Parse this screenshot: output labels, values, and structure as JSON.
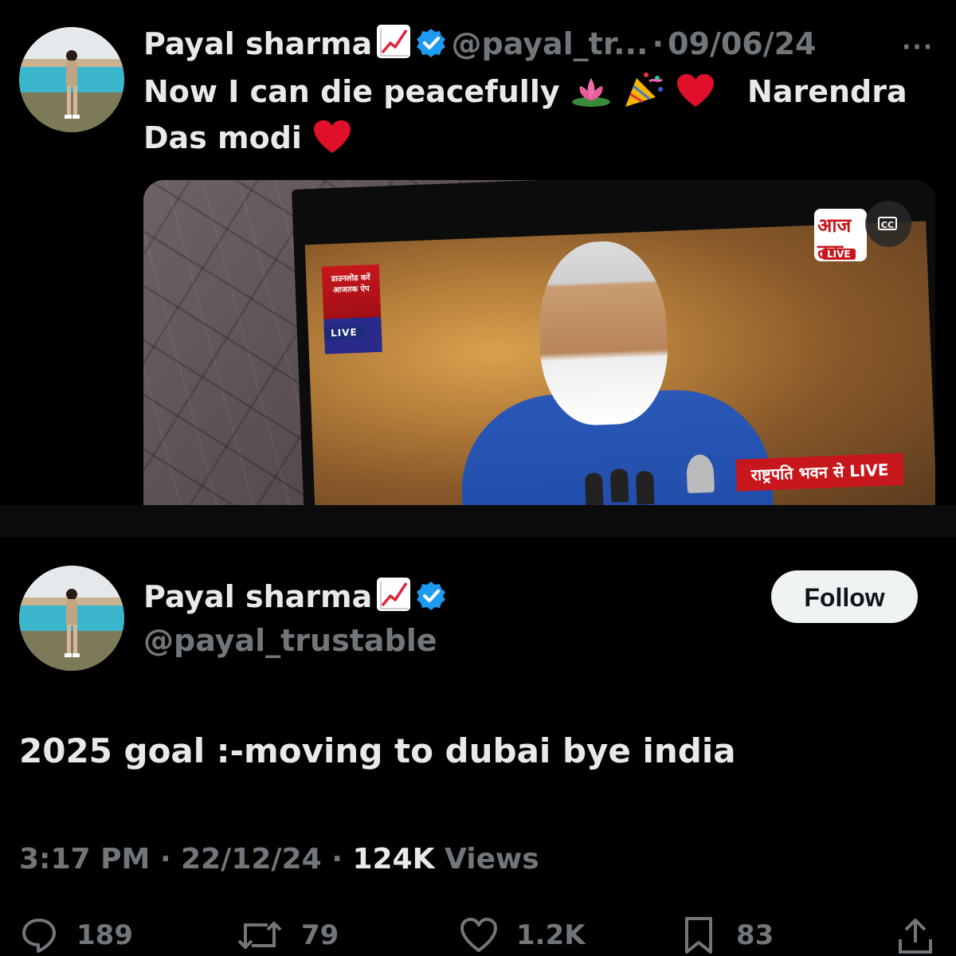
{
  "tweet1": {
    "name": "Payal sharma",
    "handle": "@payal_tr...",
    "separator": "·",
    "date": "09/06/24",
    "more": "···",
    "text_line1": "Now I can die peacefully",
    "text_line1_suffix": "Narendra",
    "text_line2": "Das modi",
    "media": {
      "banner_text": "राष्ट्रपति भवन से LIVE",
      "channel_top": "डाउनलोड करें आजतक ऐप",
      "live_badge": "LIVE",
      "logo_text": "आज तक",
      "logo_live": "LIVE",
      "cc_label": "CC"
    }
  },
  "tweet2": {
    "name": "Payal sharma",
    "handle": "@payal_trustable",
    "follow_label": "Follow",
    "text": "2025 goal :-moving to dubai bye india",
    "time": "3:17 PM",
    "sep1": "·",
    "date": "22/12/24",
    "sep2": "·",
    "views_count": "124K",
    "views_label": "Views",
    "actions": {
      "replies": "189",
      "reposts": "79",
      "likes": "1.2K",
      "bookmarks": "83"
    }
  },
  "colors": {
    "background": "#000000",
    "text_primary": "#e7e9ea",
    "text_secondary": "#71767b",
    "verified_blue": "#1d9bf0",
    "follow_bg": "#eff3f4"
  },
  "icons": [
    "chart-increasing-icon",
    "verified-badge-icon",
    "lotus-icon",
    "party-popper-icon",
    "red-heart-icon",
    "reply-icon",
    "repost-icon",
    "like-icon",
    "bookmark-icon",
    "share-icon",
    "more-icon"
  ]
}
